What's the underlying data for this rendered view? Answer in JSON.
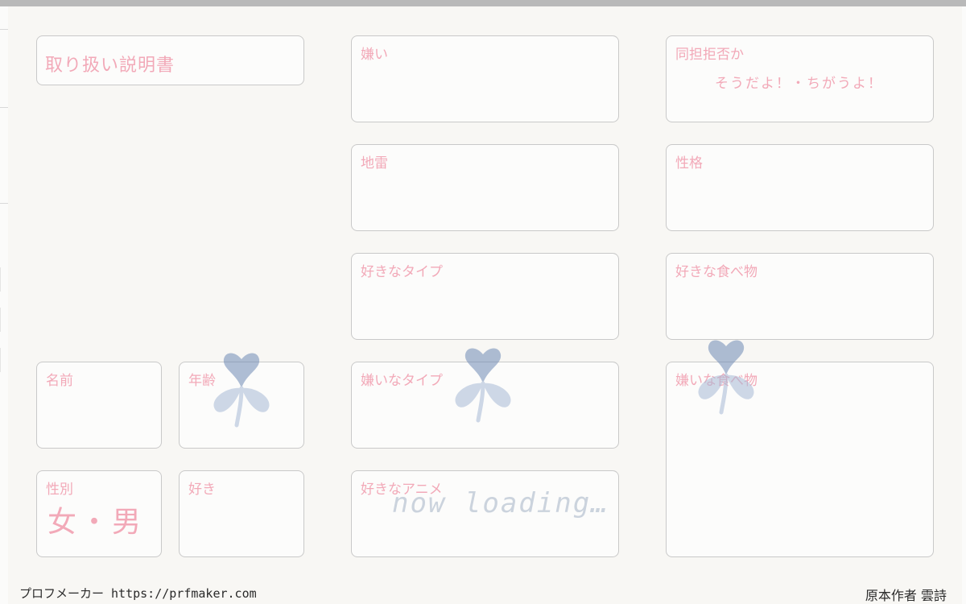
{
  "title_box": {
    "label": "取り扱い説明書"
  },
  "fields": {
    "dislikes": {
      "label": "嫌い"
    },
    "same_oshi_refusal": {
      "label": "同担拒否か",
      "value": "そうだよ！・ちがうよ！"
    },
    "landmine": {
      "label": "地雷"
    },
    "personality": {
      "label": "性格"
    },
    "favorite_type": {
      "label": "好きなタイプ"
    },
    "favorite_food": {
      "label": "好きな食べ物"
    },
    "name": {
      "label": "名前"
    },
    "age": {
      "label": "年齢"
    },
    "disliked_type": {
      "label": "嫌いなタイプ"
    },
    "disliked_food": {
      "label": "嫌いな食べ物"
    },
    "gender": {
      "label": "性別",
      "value": "女・男"
    },
    "likes": {
      "label": "好き"
    },
    "favorite_anime": {
      "label": "好きなアニメ"
    }
  },
  "overlay": {
    "loading_text": "now loading…"
  },
  "footer": {
    "left": "プロフメーカー https://prfmaker.com",
    "right": "原本作者 雲詩"
  },
  "icons": [
    "clover-icon"
  ],
  "colors": {
    "label_pink": "#f2a9b8",
    "clover_blue": "#8ea4c6",
    "box_border": "#c9c9c9",
    "card_background": "#f8f7f4"
  }
}
